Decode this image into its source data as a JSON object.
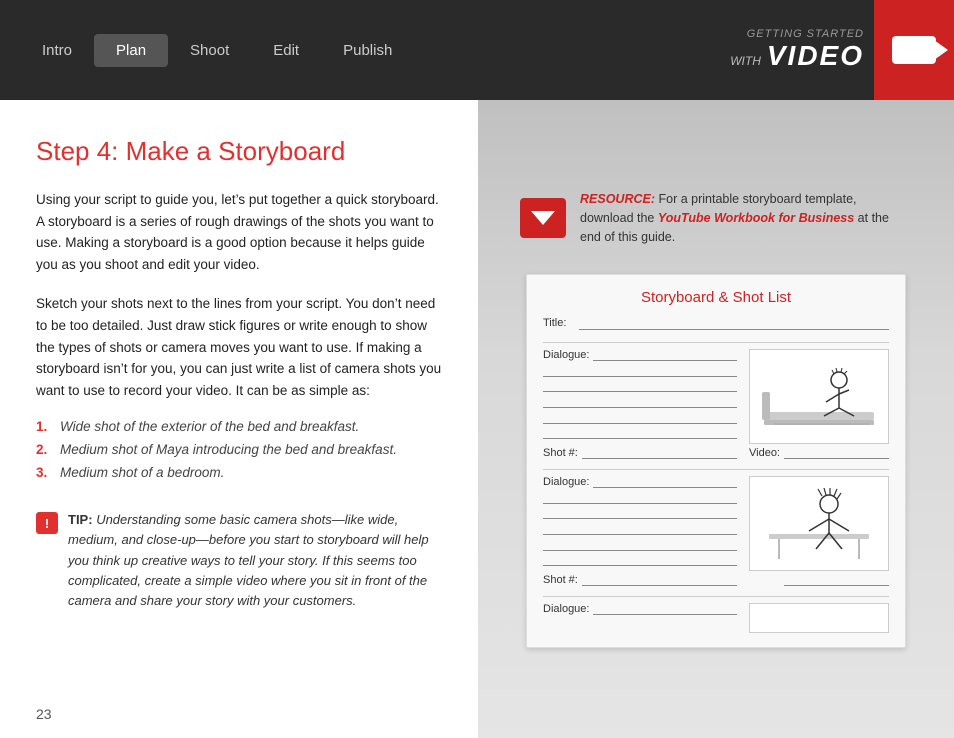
{
  "nav": {
    "items": [
      {
        "label": "Intro",
        "active": false
      },
      {
        "label": "Plan",
        "active": true
      },
      {
        "label": "Shoot",
        "active": false
      },
      {
        "label": "Edit",
        "active": false
      },
      {
        "label": "Publish",
        "active": false
      }
    ],
    "logo": {
      "getting_started": "GETTING STARTED",
      "with_label": "WITH",
      "video_label": "VIDEO"
    }
  },
  "page": {
    "step_title": "Step 4: Make a Storyboard",
    "intro_paragraph": "Using your script to guide you, let’s put together a quick storyboard. A storyboard is a series of rough drawings of the shots you want to use. Making a storyboard is a good option because it helps guide you as you shoot and edit your video.",
    "sketch_paragraph": "Sketch your shots next to the lines from your script. You don’t need to be too detailed. Just draw stick figures or write enough to show the types of shots or camera moves you want to use. If making a storyboard isn’t for you, you can just write a list of camera shots you want to use to record your video. It can be as simple as:",
    "shots": [
      {
        "num": "1.",
        "text": "Wide shot of the exterior of the bed and breakfast."
      },
      {
        "num": "2.",
        "text": "Medium shot of Maya introducing the bed and breakfast."
      },
      {
        "num": "3.",
        "text": "Medium shot of a bedroom."
      }
    ],
    "tip": {
      "label": "TIP:",
      "text": "Understanding some basic camera shots—like wide, medium, and close-up—before you start to storyboard will help you think up creative ways to tell your story. If this seems too complicated, create a simple video where you sit in front of the camera and share your story with your customers."
    },
    "page_number": "23"
  },
  "resource": {
    "label": "RESOURCE:",
    "text": "For a printable storyboard template, download the",
    "link_text": "YouTube Workbook for Business",
    "after_link": "at the end of this guide."
  },
  "storyboard": {
    "title": "Storyboard & Shot List",
    "title_label": "Title:",
    "dialogue_label": "Dialogue:",
    "shot_label": "Shot #:",
    "video_label": "Video:"
  }
}
